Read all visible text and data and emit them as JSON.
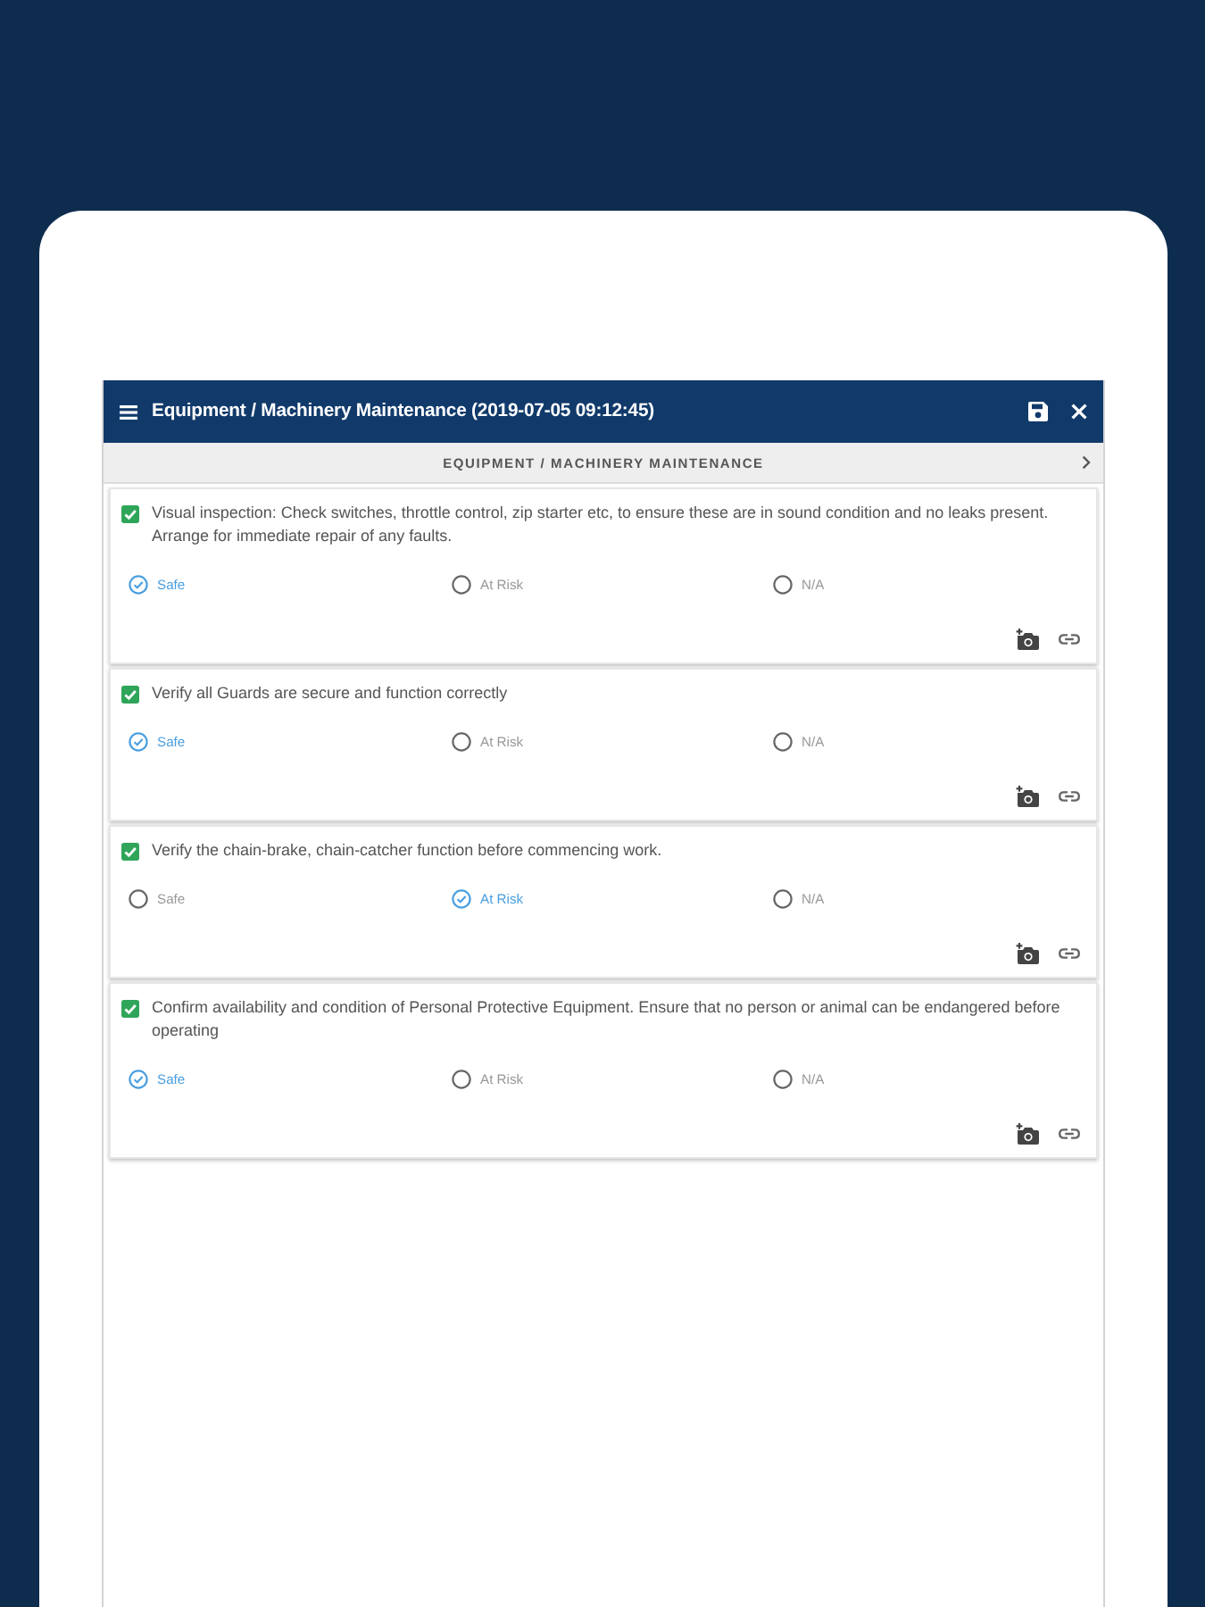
{
  "header": {
    "title": "Equipment / Machinery Maintenance (2019-07-05 09:12:45)"
  },
  "section": {
    "title": "EQUIPMENT / MACHINERY MAINTENANCE"
  },
  "items": [
    {
      "checked": true,
      "text": "Visual inspection: Check switches, throttle control, zip starter etc, to ensure these are in sound condition and no leaks present. Arrange for immediate repair of any faults.",
      "options": [
        {
          "label": "Safe",
          "selected": true
        },
        {
          "label": "At Risk",
          "selected": false
        },
        {
          "label": "N/A",
          "selected": false
        }
      ]
    },
    {
      "checked": true,
      "text": "Verify all Guards are secure and function correctly",
      "options": [
        {
          "label": "Safe",
          "selected": true
        },
        {
          "label": "At Risk",
          "selected": false
        },
        {
          "label": "N/A",
          "selected": false
        }
      ]
    },
    {
      "checked": true,
      "text": "Verify the chain-brake, chain-catcher function before commencing work.",
      "options": [
        {
          "label": "Safe",
          "selected": false
        },
        {
          "label": "At Risk",
          "selected": true
        },
        {
          "label": "N/A",
          "selected": false
        }
      ]
    },
    {
      "checked": true,
      "text": "Confirm availability and condition of Personal Protective Equipment. Ensure that no person or animal can be endangered before operating",
      "options": [
        {
          "label": "Safe",
          "selected": true
        },
        {
          "label": "At Risk",
          "selected": false
        },
        {
          "label": "N/A",
          "selected": false
        }
      ]
    }
  ]
}
